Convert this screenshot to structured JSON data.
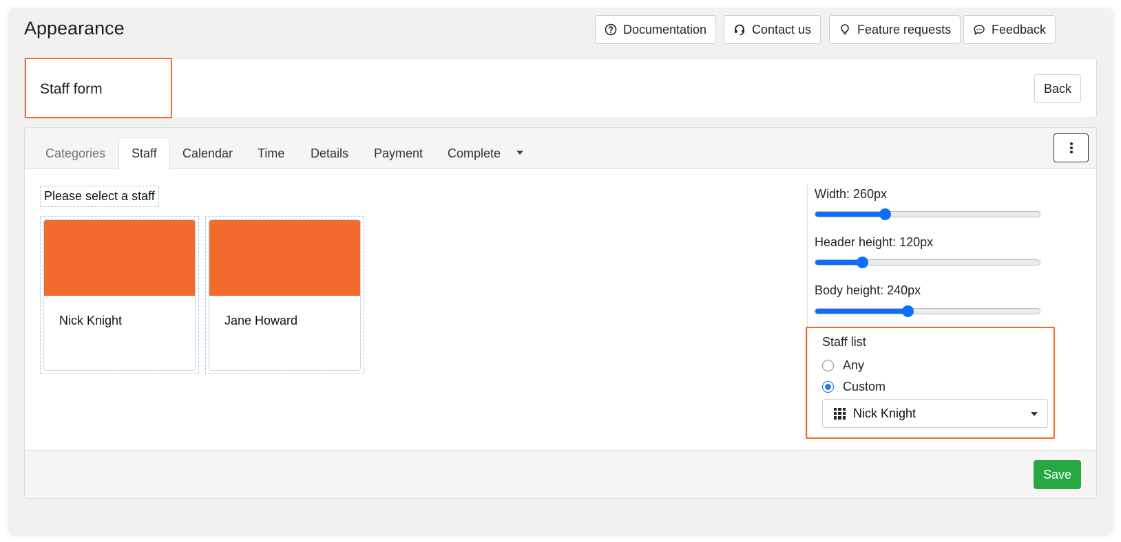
{
  "header": {
    "title": "Appearance",
    "buttons": [
      {
        "label": "Documentation",
        "icon": "question-circle-icon"
      },
      {
        "label": "Contact us",
        "icon": "headset-icon"
      },
      {
        "label": "Feature requests",
        "icon": "lightbulb-icon"
      },
      {
        "label": "Feedback",
        "icon": "chat-bubble-icon"
      }
    ]
  },
  "page": {
    "title": "Staff form",
    "back_label": "Back"
  },
  "tabs": [
    {
      "label": "Categories"
    },
    {
      "label": "Staff"
    },
    {
      "label": "Calendar"
    },
    {
      "label": "Time"
    },
    {
      "label": "Details"
    },
    {
      "label": "Payment"
    },
    {
      "label": "Complete"
    }
  ],
  "active_tab": "Staff",
  "preview": {
    "prompt": "Please select a staff",
    "staff": [
      {
        "name": "Nick Knight"
      },
      {
        "name": "Jane Howard"
      }
    ]
  },
  "settings": {
    "sliders": [
      {
        "label": "Width: 260px",
        "fraction": 0.31
      },
      {
        "label": "Header height: 120px",
        "fraction": 0.21
      },
      {
        "label": "Body height: 240px",
        "fraction": 0.41
      }
    ],
    "staff_list": {
      "title": "Staff list",
      "options": [
        {
          "label": "Any",
          "checked": false
        },
        {
          "label": "Custom",
          "checked": true
        }
      ],
      "selected": "Nick Knight"
    }
  },
  "footer": {
    "save_label": "Save"
  },
  "colors": {
    "accent": "#f26a2e",
    "primary": "#0d6efd",
    "success": "#28a745"
  }
}
